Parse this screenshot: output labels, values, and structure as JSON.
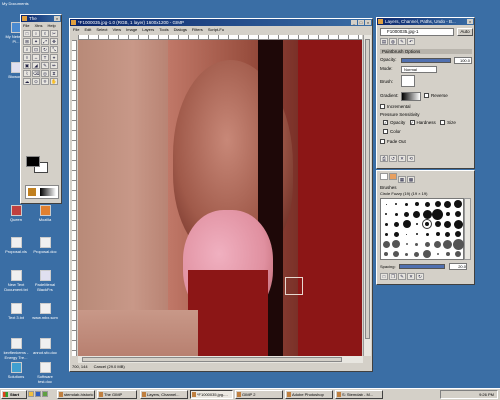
{
  "desktop": {
    "top_label": "My Documents",
    "icons": [
      {
        "label": "My Network Pl...",
        "name": "net"
      },
      {
        "label": "Bioworld",
        "name": "bio"
      },
      {
        "label": "Mozilla",
        "name": "moz"
      },
      {
        "label": "Proposal.doc",
        "name": "doc1"
      },
      {
        "label": "Queen",
        "name": "queen"
      },
      {
        "label": "Proposal.xls",
        "name": "xls1"
      },
      {
        "label": "New Text Document.txt",
        "name": "txt1"
      },
      {
        "label": "PadeMenal BlackFrs",
        "name": "pm"
      },
      {
        "label": "Text 3.txt",
        "name": "txt3"
      },
      {
        "label": "www.mbx.scm",
        "name": "www"
      },
      {
        "label": "kevflenkems - Energy Tre...",
        "name": "kev"
      },
      {
        "label": "annot.sfo.doc",
        "name": "annot"
      },
      {
        "label": "Solutions",
        "name": "sol"
      },
      {
        "label": "Software test.doc",
        "name": "soft"
      }
    ]
  },
  "toolbox": {
    "title": "The",
    "menu": [
      "File",
      "Xtns",
      "Help"
    ],
    "tools": [
      "□",
      "○",
      "ℓ",
      "✂",
      "⊞",
      "✦",
      "⤢",
      "✥",
      "⌕",
      "⊡",
      "↻",
      "⤡",
      "◊",
      "↔",
      "T",
      "⌖",
      "▣",
      "◢",
      "✎",
      "✏",
      "⌇",
      "⌫",
      "◎",
      "⧖",
      "☁",
      "⊙",
      "⍟",
      "✋"
    ]
  },
  "image_window": {
    "title": "*F1000035.jpg-1.0 (RGB, 1 layer) 1600x1200 - GIMP",
    "menu": [
      "File",
      "Edit",
      "Select",
      "View",
      "Image",
      "Layers",
      "Tools",
      "Dialogs",
      "Filters",
      "Script-Fu"
    ],
    "status_left": "700, 144",
    "status_mid": "Cancel (29.0 MB)"
  },
  "layers_dialog": {
    "title": "Layers, Channel, Paths, Undo - B...",
    "image_select": "F1000035.jpg-1",
    "auto_label": "Auto",
    "section_title": "Paintbrush Options",
    "opacity_label": "Opacity:",
    "opacity_value": "100.0",
    "mode_label": "Mode:",
    "mode_value": "Normal",
    "brush_label": "Brush:",
    "gradient_label": "Gradient:",
    "reverse_label": "Reverse",
    "incremental_label": "Incremental",
    "pressure_label": "Pressure Sensitivity",
    "pressure_opacity": "Opacity",
    "pressure_hardness": "Hardness",
    "pressure_size": "Size",
    "color_label": "Color",
    "fade_label": "Fade Out"
  },
  "brushes_dialog": {
    "title": "Brushes",
    "brush_name": "Circle Fuzzy (19) (19 × 19)",
    "spacing_label": "Spacing:",
    "spacing_value": "20.0"
  },
  "taskbar": {
    "start": "Start",
    "items": [
      {
        "label": "stemdab-historic",
        "active": false
      },
      {
        "label": "The GIMP",
        "active": false
      },
      {
        "label": "Layers, Channel...",
        "active": false
      },
      {
        "label": "*F1000035.jpg-...",
        "active": true
      },
      {
        "label": "GIMP 2",
        "active": false
      },
      {
        "label": "Adobe Photoshop",
        "active": false
      },
      {
        "label": "S: Stemdab - M...",
        "active": false
      }
    ],
    "clock": "9:26 PM"
  }
}
